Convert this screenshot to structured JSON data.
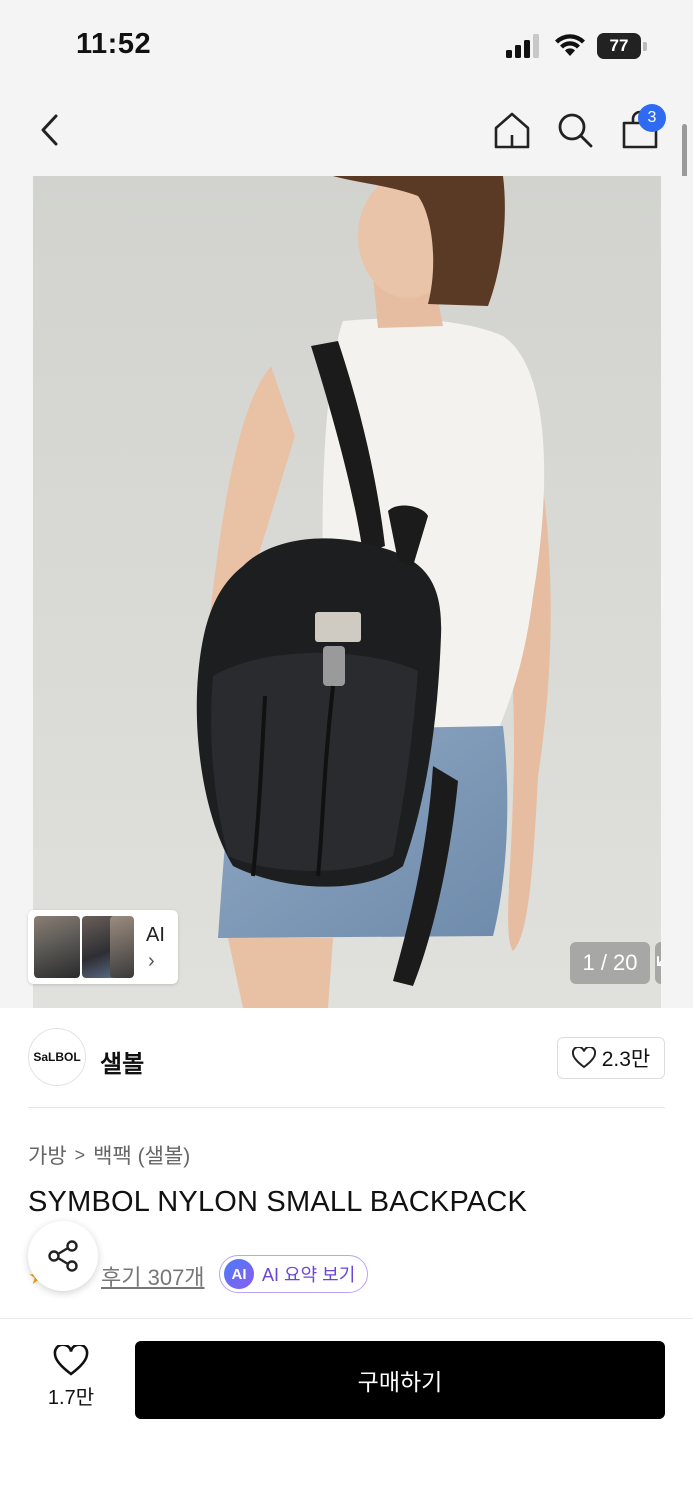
{
  "status_bar": {
    "time": "11:52",
    "battery": "77"
  },
  "nav": {
    "cart_count": "3"
  },
  "gallery": {
    "counter": "1 / 20",
    "ai_label": "AI",
    "ai_chevron": "›"
  },
  "brand": {
    "logo_text": "SaLBOL",
    "name": "샐볼",
    "like_count": "2.3만"
  },
  "product": {
    "breadcrumb": [
      "가방",
      "백팩 (샐볼)"
    ],
    "breadcrumb_separator": ">",
    "title": "SYMBOL NYLON SMALL BACKPACK",
    "reviews": "후기 307개",
    "ai_badge": "AI",
    "ai_summary": "AI 요약 보기"
  },
  "bottom_bar": {
    "wish_count": "1.7만",
    "buy_label": "구매하기"
  },
  "colors": {
    "accent_blue": "#2f6bf2",
    "buy_button": "#000000",
    "ai_purple": "#6a45d8"
  }
}
